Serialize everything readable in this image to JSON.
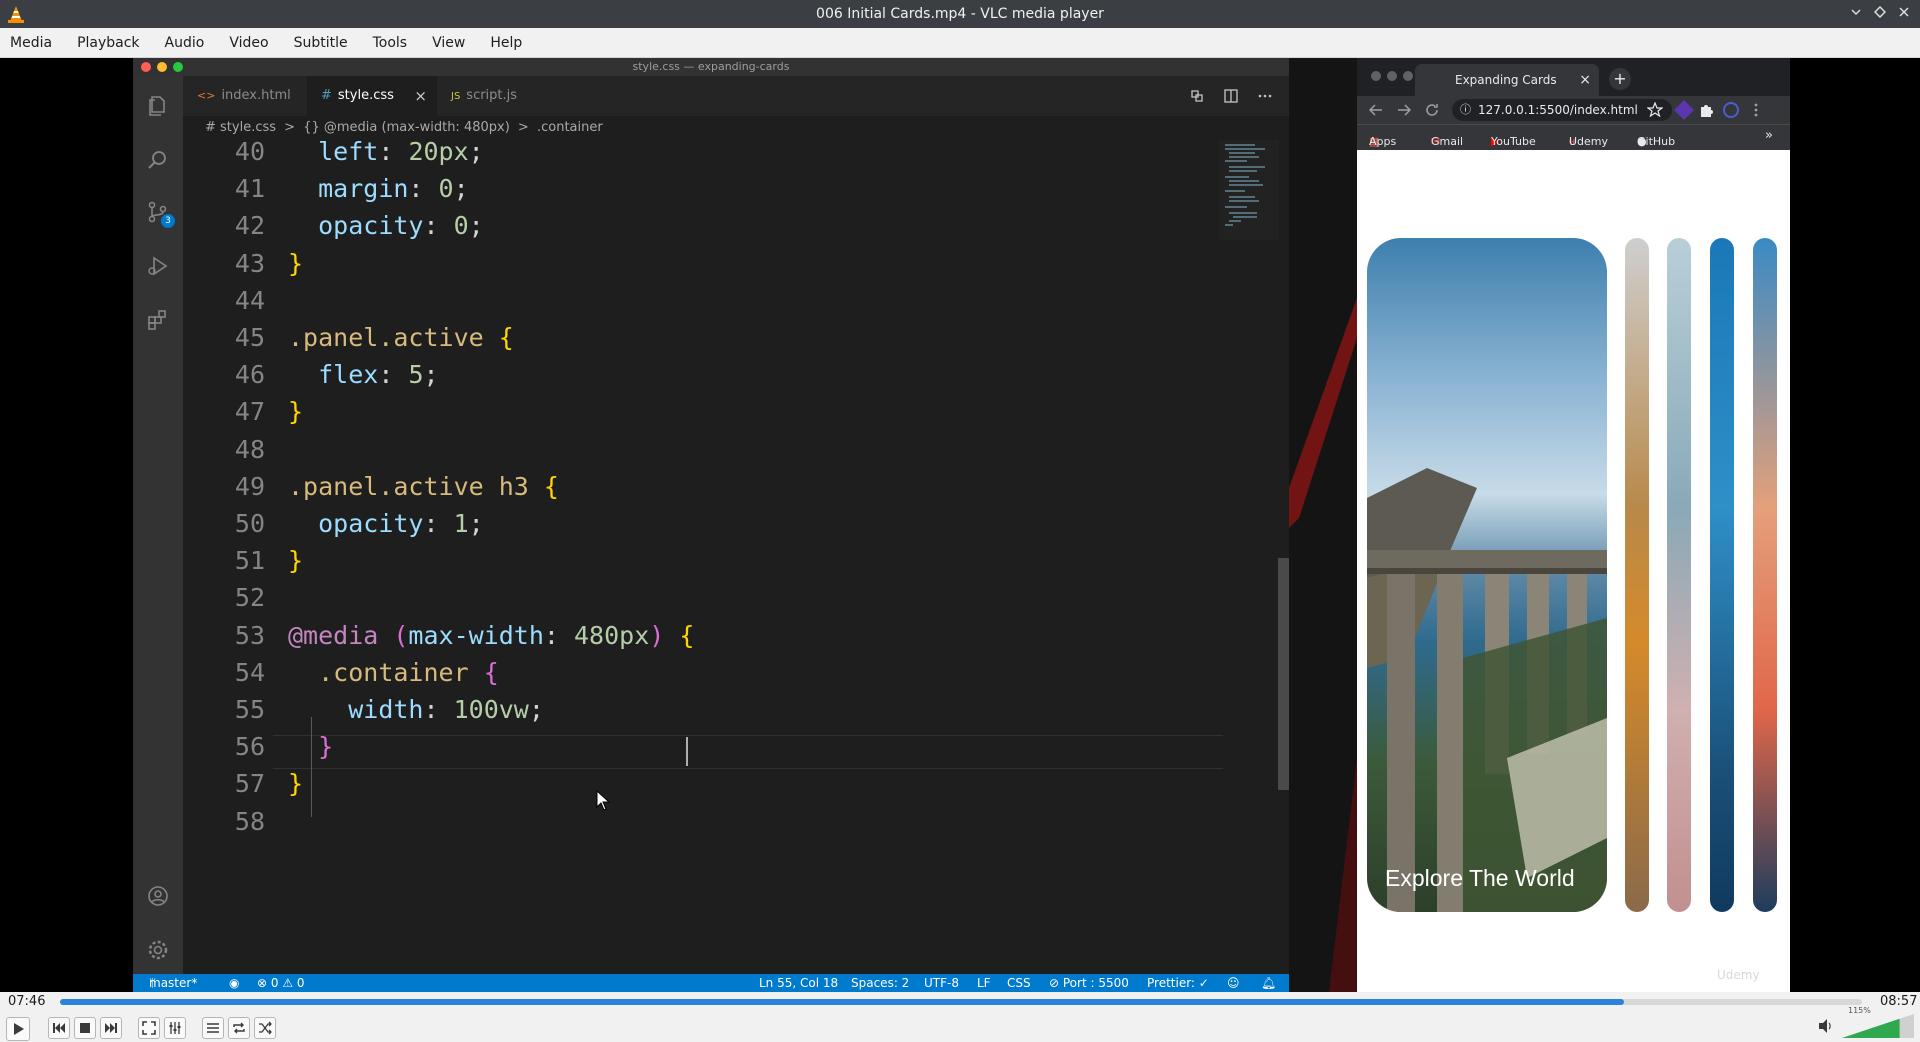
{
  "vlc": {
    "title": "006 Initial Cards.mp4 - VLC media player",
    "menu": [
      "Media",
      "Playback",
      "Audio",
      "Video",
      "Subtitle",
      "Tools",
      "View",
      "Help"
    ],
    "time_elapsed": "07:46",
    "time_total": "08:57",
    "progress_fraction": 0.868,
    "volume_label": "115%",
    "volume_fraction": 0.8
  },
  "vscode": {
    "window_title": "style.css — expanding-cards",
    "tabs": [
      {
        "label": "index.html",
        "prefix": "<>",
        "active": false
      },
      {
        "label": "style.css",
        "prefix": "#",
        "active": true,
        "close": "×"
      },
      {
        "label": "script.js",
        "prefix": "JS",
        "active": false
      }
    ],
    "breadcrumb": {
      "file": "# style.css",
      "sep1": ">",
      "media": "{} @media (max-width: 480px)",
      "sep2": ">",
      "selector": ".container"
    },
    "scm_badge": "3",
    "lines": [
      {
        "n": "40",
        "tokens": [
          [
            "  ",
            "p"
          ],
          [
            "left",
            "prop"
          ],
          [
            ": ",
            "p"
          ],
          [
            "20px",
            "num"
          ],
          [
            ";",
            "p"
          ]
        ]
      },
      {
        "n": "41",
        "tokens": [
          [
            "  ",
            "p"
          ],
          [
            "margin",
            "prop"
          ],
          [
            ": ",
            "p"
          ],
          [
            "0",
            "num"
          ],
          [
            ";",
            "p"
          ]
        ]
      },
      {
        "n": "42",
        "tokens": [
          [
            "  ",
            "p"
          ],
          [
            "opacity",
            "prop"
          ],
          [
            ": ",
            "p"
          ],
          [
            "0",
            "num"
          ],
          [
            ";",
            "p"
          ]
        ]
      },
      {
        "n": "43",
        "tokens": [
          [
            "}",
            "br"
          ]
        ]
      },
      {
        "n": "44",
        "tokens": []
      },
      {
        "n": "45",
        "tokens": [
          [
            ".panel.active ",
            "sel"
          ],
          [
            "{",
            "br"
          ]
        ]
      },
      {
        "n": "46",
        "tokens": [
          [
            "  ",
            "p"
          ],
          [
            "flex",
            "prop"
          ],
          [
            ": ",
            "p"
          ],
          [
            "5",
            "num"
          ],
          [
            ";",
            "p"
          ]
        ]
      },
      {
        "n": "47",
        "tokens": [
          [
            "}",
            "br"
          ]
        ]
      },
      {
        "n": "48",
        "tokens": []
      },
      {
        "n": "49",
        "tokens": [
          [
            ".panel.active h3 ",
            "sel"
          ],
          [
            "{",
            "br"
          ]
        ]
      },
      {
        "n": "50",
        "tokens": [
          [
            "  ",
            "p"
          ],
          [
            "opacity",
            "prop"
          ],
          [
            ": ",
            "p"
          ],
          [
            "1",
            "num"
          ],
          [
            ";",
            "p"
          ]
        ]
      },
      {
        "n": "51",
        "tokens": [
          [
            "}",
            "br"
          ]
        ]
      },
      {
        "n": "52",
        "tokens": []
      },
      {
        "n": "53",
        "tokens": [
          [
            "@media ",
            "at"
          ],
          [
            "(",
            "br2"
          ],
          [
            "max-width",
            "prop"
          ],
          [
            ": ",
            "p"
          ],
          [
            "480px",
            "num"
          ],
          [
            ") ",
            "br2"
          ],
          [
            "{",
            "br"
          ]
        ]
      },
      {
        "n": "54",
        "tokens": [
          [
            "  ",
            "p"
          ],
          [
            ".container ",
            "sel"
          ],
          [
            "{",
            "br2"
          ]
        ]
      },
      {
        "n": "55",
        "tokens": [
          [
            "    ",
            "p"
          ],
          [
            "width",
            "prop"
          ],
          [
            ": ",
            "p"
          ],
          [
            "100vw",
            "num"
          ],
          [
            ";",
            "p"
          ]
        ]
      },
      {
        "n": "56",
        "tokens": [
          [
            "  ",
            "p"
          ],
          [
            "}",
            "br2"
          ]
        ]
      },
      {
        "n": "57",
        "tokens": [
          [
            "}",
            "br"
          ]
        ]
      },
      {
        "n": "58",
        "tokens": []
      }
    ],
    "status": {
      "branch": "master*",
      "problems": "⊗ 0 ⚠ 0",
      "position": "Ln 55, Col 18",
      "spaces": "Spaces: 2",
      "encoding": "UTF-8",
      "eol": "LF",
      "language": "CSS",
      "port": "⊘ Port : 5500",
      "prettier": "Prettier: ✓"
    }
  },
  "browser": {
    "tab_title": "Expanding Cards",
    "tab_close": "×",
    "url": "127.0.0.1:5500/index.html",
    "bookmarks": [
      "Apps",
      "Gmail",
      "YouTube",
      "Udemy",
      "GitHub"
    ],
    "bookmarks_more": "»",
    "card_caption": "Explore The World",
    "watermark": "Udemy"
  }
}
